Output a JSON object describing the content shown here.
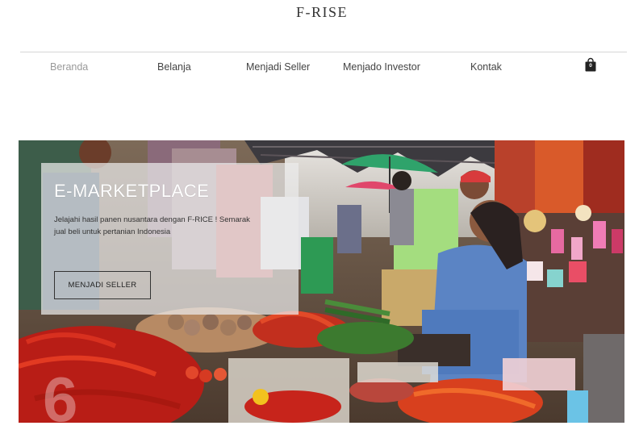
{
  "header": {
    "title": "F-RISE"
  },
  "nav": {
    "items": [
      {
        "label": "Beranda"
      },
      {
        "label": "Belanja"
      },
      {
        "label": "Menjadi Seller"
      },
      {
        "label": "Menjado Investor"
      },
      {
        "label": "Kontak"
      }
    ],
    "cart_count": "0",
    "cart_icon": "shopping-bag-icon"
  },
  "hero": {
    "title": "E-MARKETPLACE",
    "description": "Jelajahi hasil panen nusantara dengan F-RICE ! Semarak jual beli untuk pertanian Indonesia",
    "button_label": "MENJADI SELLER",
    "image_subject": "traditional vegetable market stall with chili peppers and vendor",
    "watermark": "6"
  },
  "colors": {
    "nav_active": "#9a9a9a",
    "nav_text": "#444444",
    "overlay_bg": "rgba(235,235,235,0.72)"
  }
}
